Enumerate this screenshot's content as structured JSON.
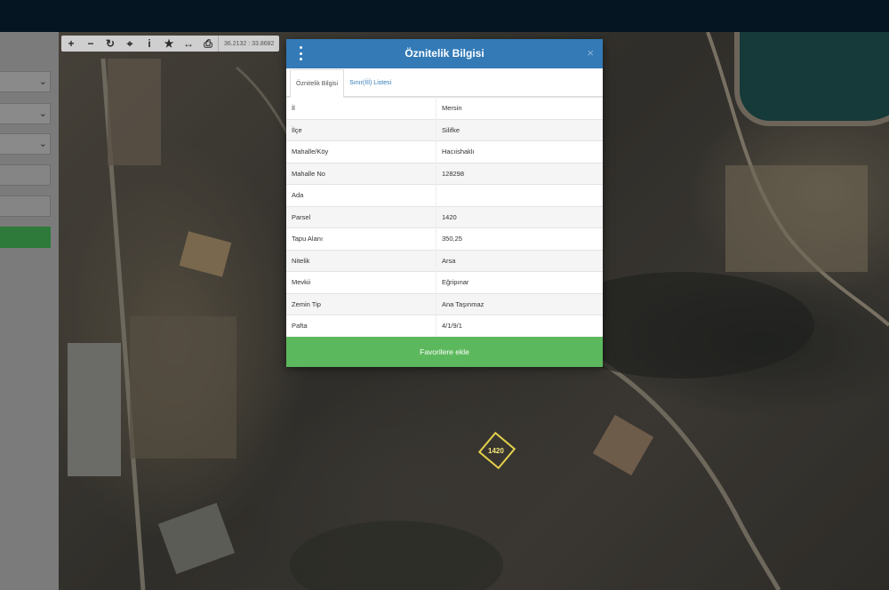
{
  "toolbar": {
    "buttons": [
      {
        "icon": "plus-icon",
        "glyph": "+"
      },
      {
        "icon": "minus-icon",
        "glyph": "−"
      },
      {
        "icon": "refresh-icon",
        "glyph": "↻"
      },
      {
        "icon": "crosshair-icon",
        "glyph": "⌖"
      },
      {
        "icon": "info-icon",
        "glyph": "i"
      },
      {
        "icon": "star-icon",
        "glyph": "★"
      },
      {
        "icon": "ruler-icon",
        "glyph": "↔"
      },
      {
        "icon": "print-icon",
        "glyph": "⎙"
      }
    ],
    "coordinates": "36.2132 : 33.8682"
  },
  "modal": {
    "title": "Öznitelik Bilgisi",
    "close_glyph": "×",
    "tabs": [
      {
        "label": "Öznitelik Bilgisi",
        "active": true
      },
      {
        "label": "Sınır(İİİ) Listesi",
        "active": false
      }
    ],
    "rows": [
      {
        "key": "İl",
        "value": "Mersin"
      },
      {
        "key": "İlçe",
        "value": "Silifke"
      },
      {
        "key": "Mahalle/Köy",
        "value": "Hacıishaklı"
      },
      {
        "key": "Mahalle No",
        "value": "128298"
      },
      {
        "key": "Ada",
        "value": ""
      },
      {
        "key": "Parsel",
        "value": "1420"
      },
      {
        "key": "Tapu Alanı",
        "value": "350,25"
      },
      {
        "key": "Nitelik",
        "value": "Arsa"
      },
      {
        "key": "Mevkii",
        "value": "Eğripınar"
      },
      {
        "key": "Zemin Tip",
        "value": "Ana Taşınmaz"
      },
      {
        "key": "Pafta",
        "value": "4/1/9/1"
      }
    ],
    "favorite_button": "Favorilere ekle"
  },
  "map": {
    "parcel_label": "1420"
  },
  "colors": {
    "header_blue": "#337ab7",
    "button_green": "#5cb85c",
    "parcel_yellow": "#e5d24a"
  }
}
